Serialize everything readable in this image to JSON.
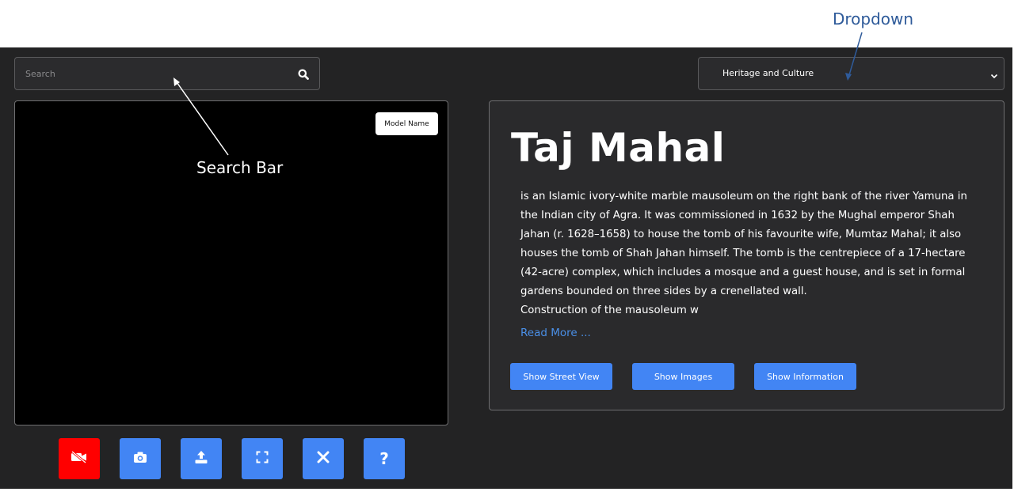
{
  "search": {
    "placeholder": "Search",
    "icon": "search-icon"
  },
  "dropdown": {
    "selected": "Heritage and Culture",
    "icon": "chevron-down-icon"
  },
  "viewer": {
    "model_label": "Model Name"
  },
  "controls": [
    {
      "icon": "video-off-icon",
      "color": "#ff0000"
    },
    {
      "icon": "camera-icon",
      "color": "#4285f4"
    },
    {
      "icon": "upload-icon",
      "color": "#4285f4"
    },
    {
      "icon": "fullscreen-icon",
      "color": "#4285f4"
    },
    {
      "icon": "close-icon",
      "color": "#4285f4"
    },
    {
      "icon": "help-icon",
      "glyph": "?",
      "color": "#4285f4"
    }
  ],
  "info": {
    "title": "Taj Mahal",
    "description": "is an Islamic ivory-white marble mausoleum on the right bank of the river Yamuna in the Indian city of Agra. It was commissioned in 1632 by the Mughal emperor Shah Jahan (r. 1628–1658) to house the tomb of his favourite wife, Mumtaz Mahal; it also houses the tomb of Shah Jahan himself. The tomb is the centrepiece of a 17-hectare (42-acre) complex, which includes a mosque and a guest house, and is set in formal gardens bounded on three sides by a crenellated wall.",
    "description_tail": "Construction of the mausoleum w",
    "read_more": "Read More ...",
    "buttons": [
      "Show Street View",
      "Show Images",
      "Show Information"
    ]
  },
  "annotations": {
    "dropdown": "Dropdown",
    "search_bar": "Search Bar"
  },
  "colors": {
    "background": "#232324",
    "accent": "#4285f4",
    "danger": "#ff0000",
    "link": "#4a8fe7"
  }
}
